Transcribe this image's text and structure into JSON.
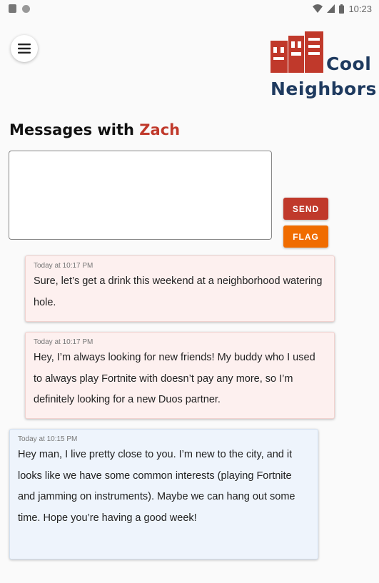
{
  "status_bar": {
    "time": "10:23"
  },
  "header": {
    "menu_icon": "hamburger-menu-icon",
    "logo": {
      "line1": "Cool",
      "line2": "Neighbors",
      "icon": "buildings-logo-icon",
      "color_primary": "#c0392b",
      "color_text": "#1e3a5f"
    }
  },
  "conversation": {
    "title_prefix": "Messages with",
    "contact_name": "Zach",
    "name_color": "#c0392b",
    "input": {
      "value": "",
      "placeholder": ""
    },
    "send_label": "SEND",
    "flag_label": "FLAG",
    "send_color": "#c0392b",
    "flag_color": "#f06c00"
  },
  "messages": [
    {
      "direction": "sent",
      "timestamp": "Today at 10:17 PM",
      "text": "Sure, let’s get a drink this weekend at a neighborhood watering hole."
    },
    {
      "direction": "sent",
      "timestamp": "Today at 10:17 PM",
      "text": "Hey, I’m always looking for new friends!  My buddy who I used to always play Fortnite with doesn’t pay any more, so I’m definitely looking for a new Duos partner."
    },
    {
      "direction": "received",
      "timestamp": "Today at 10:15 PM",
      "text": "Hey man, I live pretty close to you.  I’m new to the city, and it looks like we have some common interests (playing Fortnite and jamming on instruments).  Maybe we can hang out some time.  Hope you’re having a good week!"
    }
  ]
}
